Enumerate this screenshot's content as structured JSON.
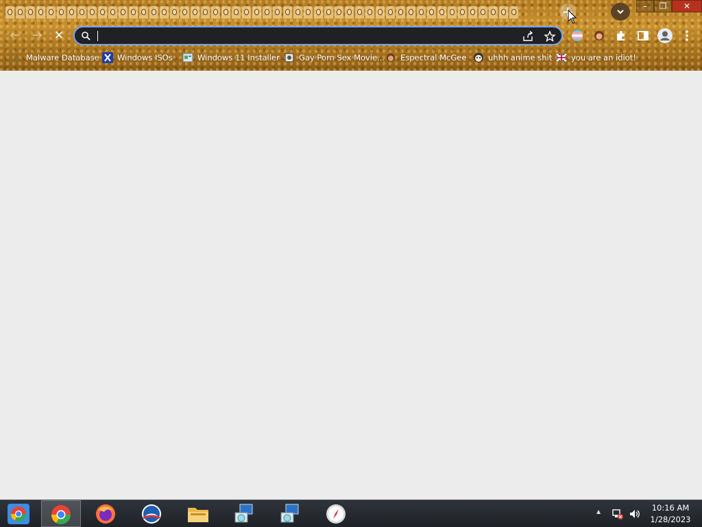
{
  "window": {
    "tab_count": 50,
    "new_tab_glyph": "+",
    "tab_search_glyph": "⌄",
    "minimize_glyph": "–",
    "restore_glyph": "❐",
    "close_glyph": "✕"
  },
  "toolbar": {
    "back_glyph": "←",
    "forward_glyph": "→",
    "stop_glyph": "✕",
    "omnibox_value": "",
    "omnibox_placeholder": ""
  },
  "bookmarks": [
    {
      "label": "Malware Database",
      "icon": "malware-favicon"
    },
    {
      "label": "Windows ISOs",
      "icon": "x-favicon"
    },
    {
      "label": "Windows 11 Installer",
      "icon": "installer-favicon"
    },
    {
      "label": "Gay Porn Sex Movie...",
      "icon": "site-favicon"
    },
    {
      "label": "Espectral McGee",
      "icon": "face-favicon"
    },
    {
      "label": "uhhh anime shit",
      "icon": "anime-favicon"
    },
    {
      "label": "you are an idiot!",
      "icon": "flag-favicon"
    }
  ],
  "taskbar": {
    "apps": [
      "chromium",
      "chrome",
      "firefox",
      "opera",
      "file-explorer",
      "setup-installer",
      "setup-installer-2",
      "safari"
    ],
    "clock_time": "10:16 AM",
    "clock_date": "1/28/2023",
    "tray_arrow": "▲"
  },
  "colors": {
    "accent_focus": "#6fa3ff",
    "omnibox_bg": "#202124",
    "content_bg": "#ececec",
    "taskbar_bg": "#1e2227"
  }
}
